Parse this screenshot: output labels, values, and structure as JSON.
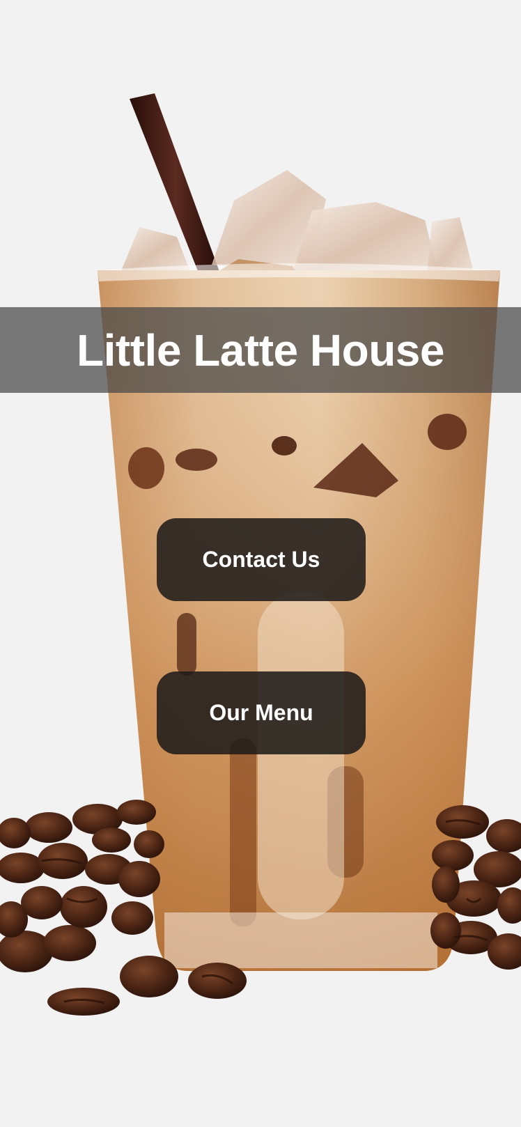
{
  "site": {
    "title": "Little Latte House"
  },
  "actions": {
    "contact_label": "Contact Us",
    "menu_label": "Our Menu"
  },
  "hero_image": {
    "subject": "iced-latte-with-coffee-beans"
  },
  "colors": {
    "page_background": "#f2f2f2",
    "title_band": "#464646",
    "button_background": "#1c1a18",
    "button_text": "#ffffff",
    "latte": "#d9b48d",
    "espresso": "#5a2f17",
    "straw": "#3a1a12",
    "coffee_bean": "#4a2616"
  }
}
